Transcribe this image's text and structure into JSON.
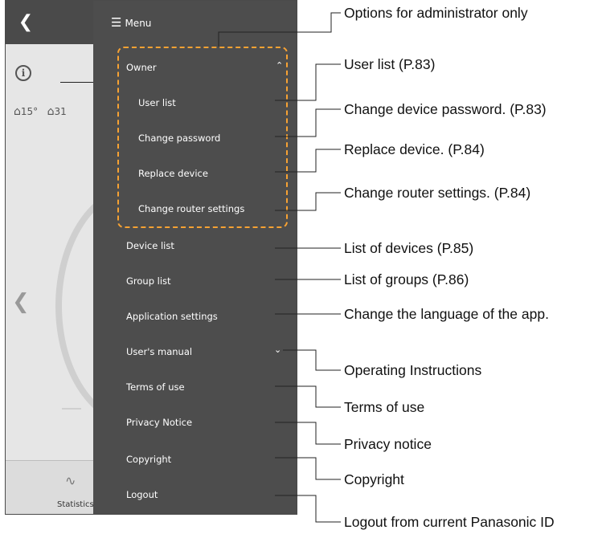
{
  "background_app": {
    "temps": [
      "15°",
      "31"
    ],
    "bottom_tab_label": "Statistics"
  },
  "menu": {
    "title": "Menu",
    "owner_section": {
      "label": "Owner",
      "items": [
        "User list",
        "Change password",
        "Replace device",
        "Change router settings"
      ]
    },
    "items": [
      "Device list",
      "Group list",
      "Application settings",
      "User's manual",
      "Terms of use",
      "Privacy Notice",
      "Copyright",
      "Logout"
    ]
  },
  "callouts": {
    "admin": "Options for administrator only",
    "user_list": "User list (P.83)",
    "change_password": "Change device password. (P.83)",
    "replace_device": "Replace device. (P.84)",
    "router": "Change router settings. (P.84)",
    "device_list": "List of devices (P.85)",
    "group_list": "List of groups (P.86)",
    "app_settings": "Change the language of the app.",
    "manual": "Operating Instructions",
    "terms": "Terms of use",
    "privacy": "Privacy notice",
    "copyright": "Copyright",
    "logout": "Logout from current Panasonic ID"
  },
  "colors": {
    "menu_bg": "#4d4d4d",
    "admin_outline": "#f7a233"
  }
}
